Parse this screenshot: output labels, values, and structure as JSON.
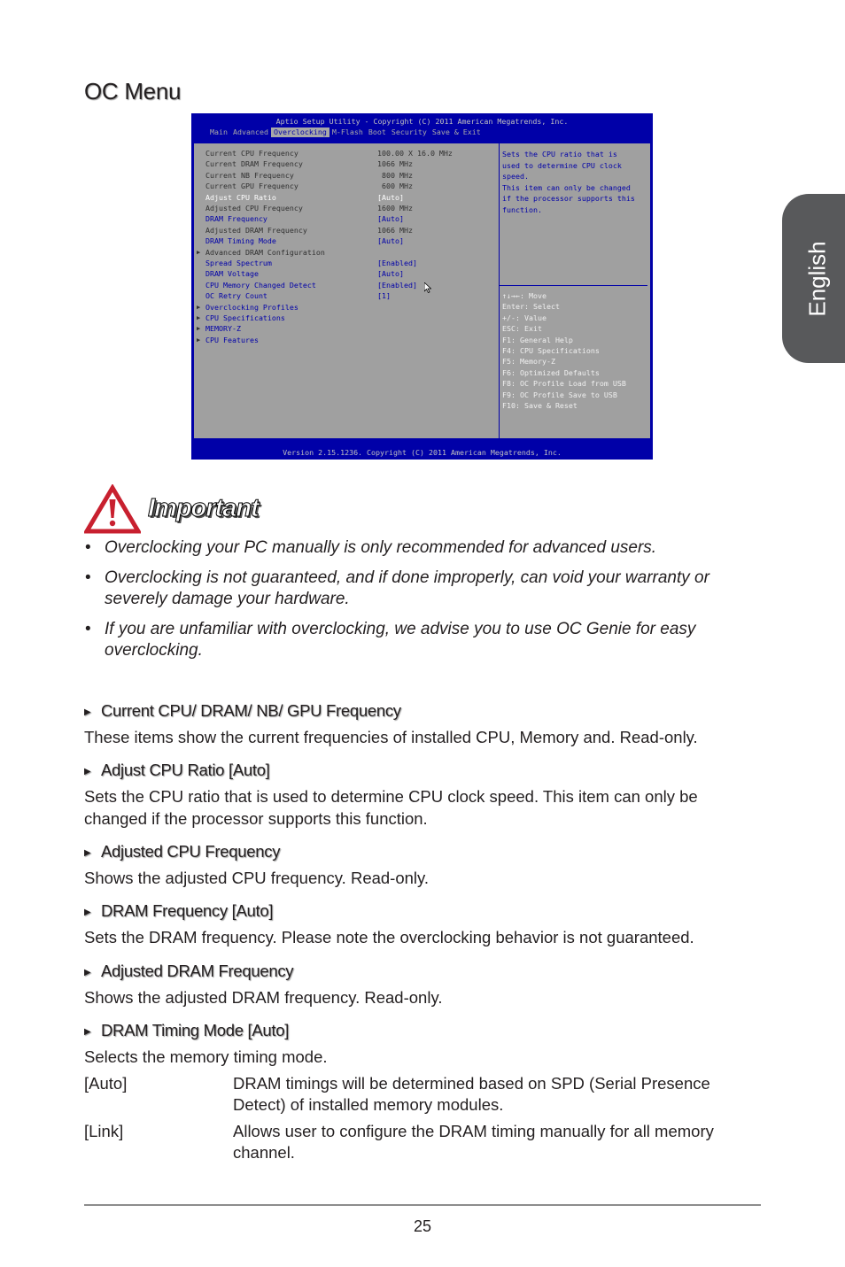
{
  "page": {
    "title": "OC Menu",
    "side_tab": "English",
    "page_number": "25"
  },
  "bios": {
    "title": "Aptio Setup Utility - Copyright (C) 2011 American Megatrends, Inc.",
    "tabs": [
      {
        "label": "Main",
        "active": false
      },
      {
        "label": "Advanced",
        "active": false
      },
      {
        "label": "Overclocking",
        "active": true
      },
      {
        "label": "M-Flash",
        "active": false
      },
      {
        "label": "Boot",
        "active": false
      },
      {
        "label": "Security",
        "active": false
      },
      {
        "label": "Save & Exit",
        "active": false
      }
    ],
    "items": [
      {
        "label": "Current CPU Frequency",
        "value": "100.00 X 16.0 MHz",
        "style": "dark",
        "submenu": false
      },
      {
        "label": "Current DRAM Frequency",
        "value": "1066 MHz",
        "style": "dark",
        "submenu": false
      },
      {
        "label": "Current NB Frequency",
        "value": " 800 MHz",
        "style": "dark",
        "submenu": false
      },
      {
        "label": "Current GPU Frequency",
        "value": " 600 MHz",
        "style": "dark",
        "submenu": false
      },
      {
        "label": "Adjust CPU Ratio",
        "value": "[Auto]",
        "style": "selected",
        "submenu": false
      },
      {
        "label": "Adjusted CPU Frequency",
        "value": "1600 MHz",
        "style": "dark",
        "submenu": false
      },
      {
        "label": "DRAM Frequency",
        "value": "[Auto]",
        "style": "blue",
        "submenu": false
      },
      {
        "label": "Adjusted DRAM Frequency",
        "value": "1066 MHz",
        "style": "dark",
        "submenu": false
      },
      {
        "label": "DRAM Timing Mode",
        "value": "[Auto]",
        "style": "blue",
        "submenu": false
      },
      {
        "label": "Advanced DRAM Configuration",
        "value": "",
        "style": "dark",
        "submenu": true
      },
      {
        "label": "Spread Spectrum",
        "value": "[Enabled]",
        "style": "blue",
        "submenu": false
      },
      {
        "label": "DRAM Voltage",
        "value": "[Auto]",
        "style": "blue",
        "submenu": false
      },
      {
        "label": "CPU Memory Changed Detect",
        "value": "[Enabled]",
        "style": "blue",
        "submenu": false
      },
      {
        "label": "OC Retry Count",
        "value": "[1]",
        "style": "blue",
        "submenu": false
      },
      {
        "label": "Overclocking Profiles",
        "value": "",
        "style": "blue",
        "submenu": true
      },
      {
        "label": "CPU Specifications",
        "value": "",
        "style": "blue",
        "submenu": true
      },
      {
        "label": "MEMORY-Z",
        "value": "",
        "style": "blue",
        "submenu": true
      },
      {
        "label": "CPU Features",
        "value": "",
        "style": "blue",
        "submenu": true
      }
    ],
    "help_lines": [
      "Sets the CPU ratio that is",
      "used to determine CPU clock",
      "speed.",
      "This item can only be changed",
      "if the processor supports this",
      "function."
    ],
    "keys": [
      "↑↓→←: Move",
      "Enter: Select",
      "+/-: Value",
      "ESC: Exit",
      "F1: General Help",
      "F4: CPU Specifications",
      "F5: Memory-Z",
      "F6: Optimized Defaults",
      "F8: OC Profile Load from USB",
      "F9: OC Profile Save to USB",
      "F10: Save & Reset"
    ],
    "footer": "Version 2.15.1236. Copyright (C) 2011 American Megatrends, Inc."
  },
  "important": {
    "label": "Important",
    "bullets": [
      "Overclocking your PC manually is only recommended for advanced users.",
      "Overclocking is not guaranteed, and if done improperly, can void your warranty or severely damage your hardware.",
      "If you are unfamiliar with overclocking, we advise you to use OC Genie for easy overclocking."
    ]
  },
  "sections": [
    {
      "heading": "Current CPU/ DRAM/ NB/ GPU Frequency",
      "body": "These items show the current frequencies of installed CPU, Memory and. Read-only."
    },
    {
      "heading": "Adjust CPU Ratio [Auto]",
      "body": "Sets the CPU ratio that is used to determine CPU clock speed. This item can only be changed if the processor supports this function."
    },
    {
      "heading": "Adjusted CPU Frequency",
      "body": "Shows the adjusted CPU frequency. Read-only."
    },
    {
      "heading": "DRAM Frequency [Auto]",
      "body": "Sets the DRAM frequency. Please note the overclocking behavior is not guaranteed."
    },
    {
      "heading": "Adjusted DRAM Frequency",
      "body": "Shows the adjusted DRAM frequency. Read-only."
    },
    {
      "heading": "DRAM Timing Mode [Auto]",
      "body": "Selects the memory timing mode.",
      "options": [
        {
          "key": "[Auto]",
          "desc": "DRAM timings will be determined based on SPD (Serial Presence Detect) of installed memory modules."
        },
        {
          "key": "[Link]",
          "desc": "Allows user to configure the DRAM timing manually for all memory channel."
        }
      ]
    }
  ]
}
